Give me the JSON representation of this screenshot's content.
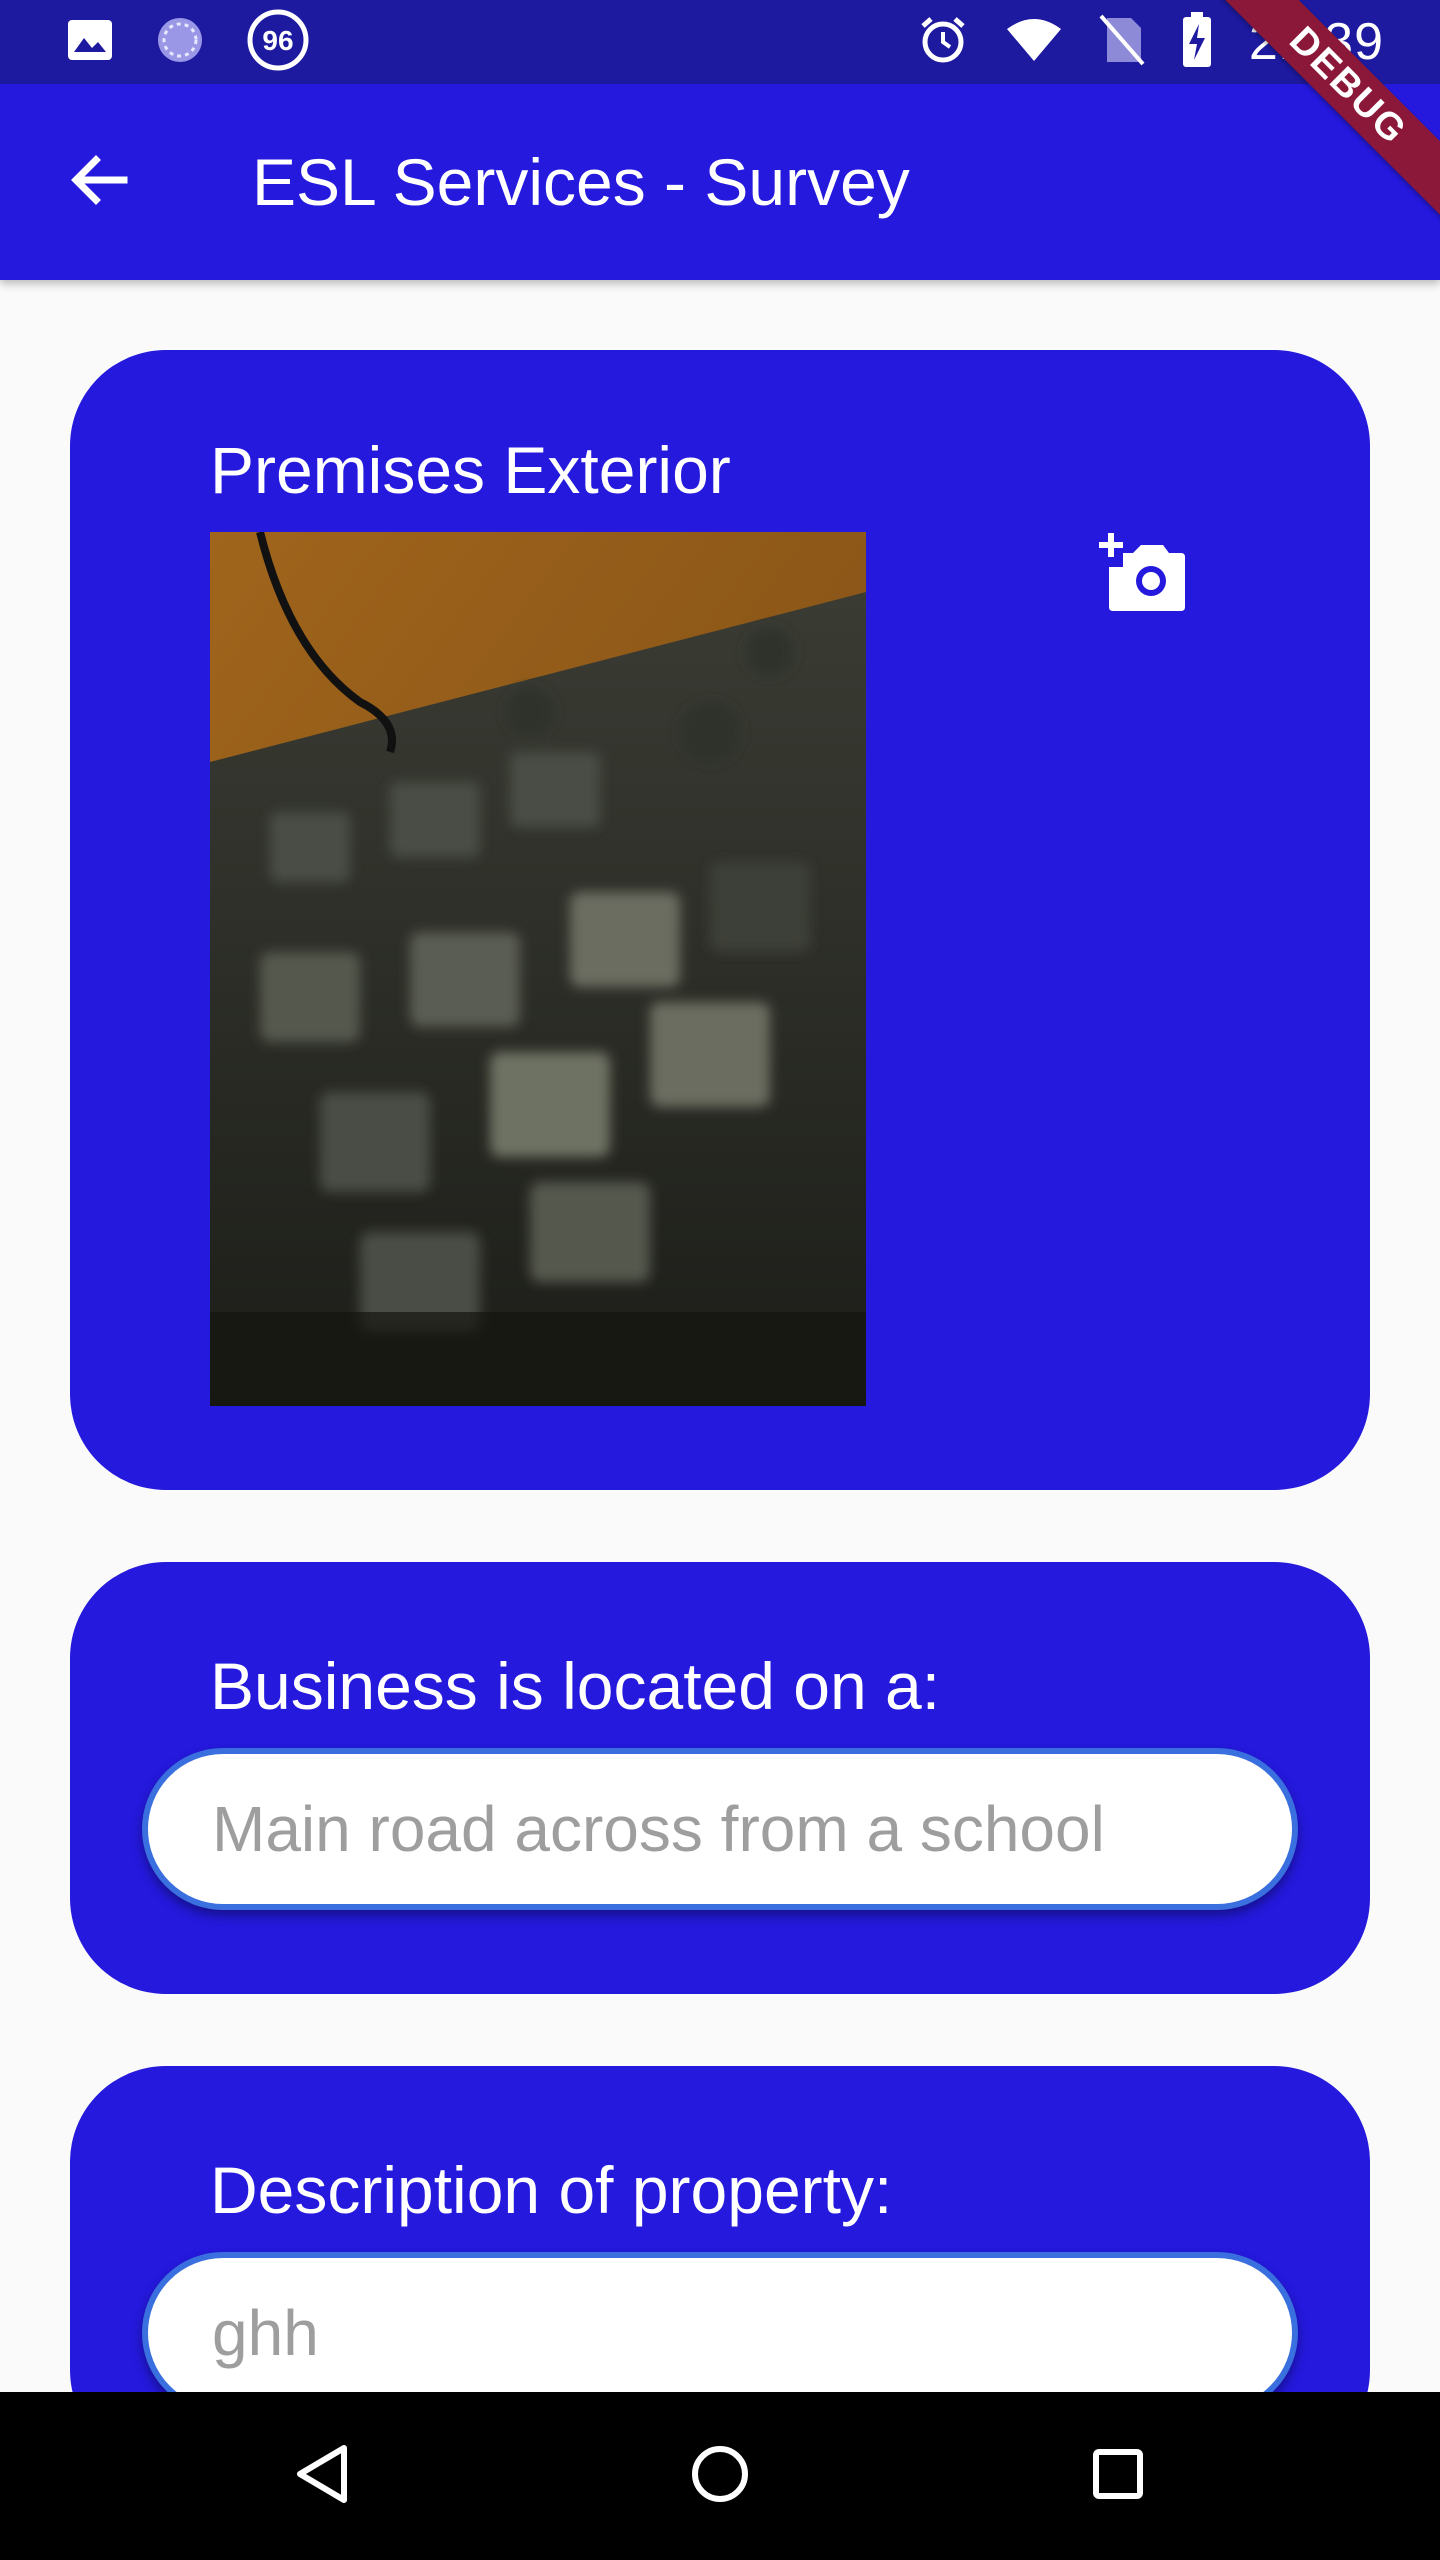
{
  "status_bar": {
    "time": "21:39",
    "left_icons": [
      "image-icon",
      "sync-icon",
      "badge-96-icon"
    ],
    "badge_text": "96",
    "right_icons": [
      "alarm-icon",
      "wifi-icon",
      "no-sim-icon",
      "battery-charging-icon"
    ]
  },
  "app_bar": {
    "title": "ESL Services - Survey",
    "back_icon": "arrow-back-icon"
  },
  "debug_banner": "DEBUG",
  "cards": {
    "photo": {
      "label": "Premises Exterior",
      "action_icon": "add-a-photo-icon"
    },
    "location": {
      "label": "Business is located on a:",
      "value": "Main road across from a school"
    },
    "description": {
      "label": "Description of property:",
      "value": "ghh"
    }
  },
  "nav_bar": {
    "icons": [
      "back-triangle-icon",
      "home-circle-icon",
      "recents-square-icon"
    ]
  },
  "colors": {
    "status_bar": "#1d1aa0",
    "app_bar": "#2419dc",
    "card": "#2419dc",
    "field_border": "#3a6fe0",
    "background": "#fafafa",
    "placeholder_text": "#9e9e9e"
  }
}
